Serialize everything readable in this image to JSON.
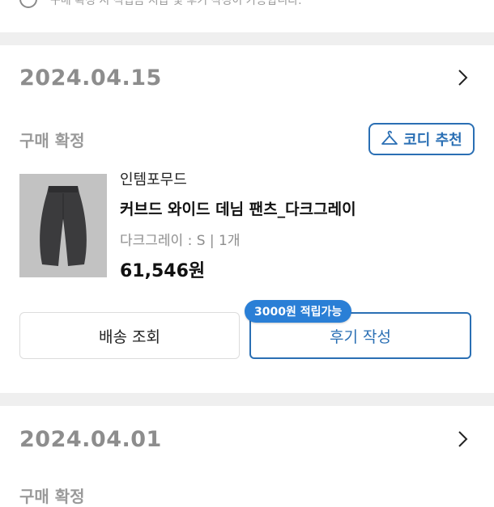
{
  "notice": {
    "text": "구매 확정 시 적립금 지급 및 후기 작성이 가능합니다."
  },
  "orders": [
    {
      "date": "2024.04.15",
      "status": "구매 확정",
      "codi_button": "코디 추천",
      "brand": "인템포무드",
      "product_name": "커브드 와이드 데님 팬츠_다크그레이",
      "option": "다크그레이 : S  |  1개",
      "price": "61,546원",
      "ship_button": "배송 조회",
      "review_button": "후기 작성",
      "review_badge": "3000원 적립가능"
    },
    {
      "date": "2024.04.01",
      "status": "구매 확정"
    }
  ],
  "colors": {
    "accent": "#2a6fb4",
    "badge": "#2a7fd6",
    "muted_text": "#8d8d8d",
    "divider": "#efefef"
  },
  "icons": {
    "chevron": "chevron-right-icon",
    "hanger": "hanger-icon",
    "notice": "info-circle-icon"
  }
}
